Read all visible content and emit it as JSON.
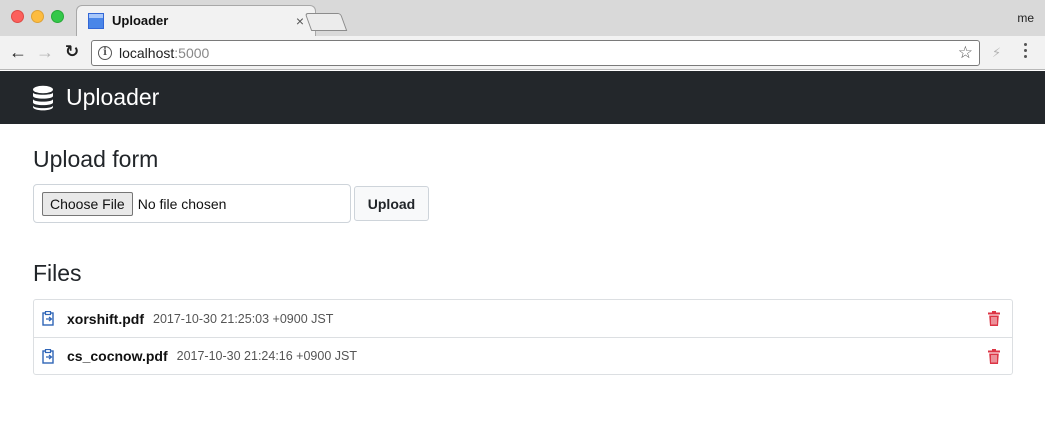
{
  "browser": {
    "tab_title": "Uploader",
    "tab_close": "×",
    "profile": "me",
    "url_host": "localhost",
    "url_port": ":5000"
  },
  "app": {
    "brand": "Uploader",
    "brand_icon": "database-icon",
    "colors": {
      "navbar": "#23272b",
      "delete": "#dc3545",
      "file_icon": "#2f65b7"
    }
  },
  "upload_form": {
    "heading": "Upload form",
    "choose_label": "Choose File",
    "no_file": "No file chosen",
    "submit_label": "Upload"
  },
  "files": {
    "heading": "Files",
    "items": [
      {
        "name": "xorshift.pdf",
        "date": "2017-10-30 21:25:03 +0900 JST"
      },
      {
        "name": "cs_cocnow.pdf",
        "date": "2017-10-30 21:24:16 +0900 JST"
      }
    ]
  }
}
